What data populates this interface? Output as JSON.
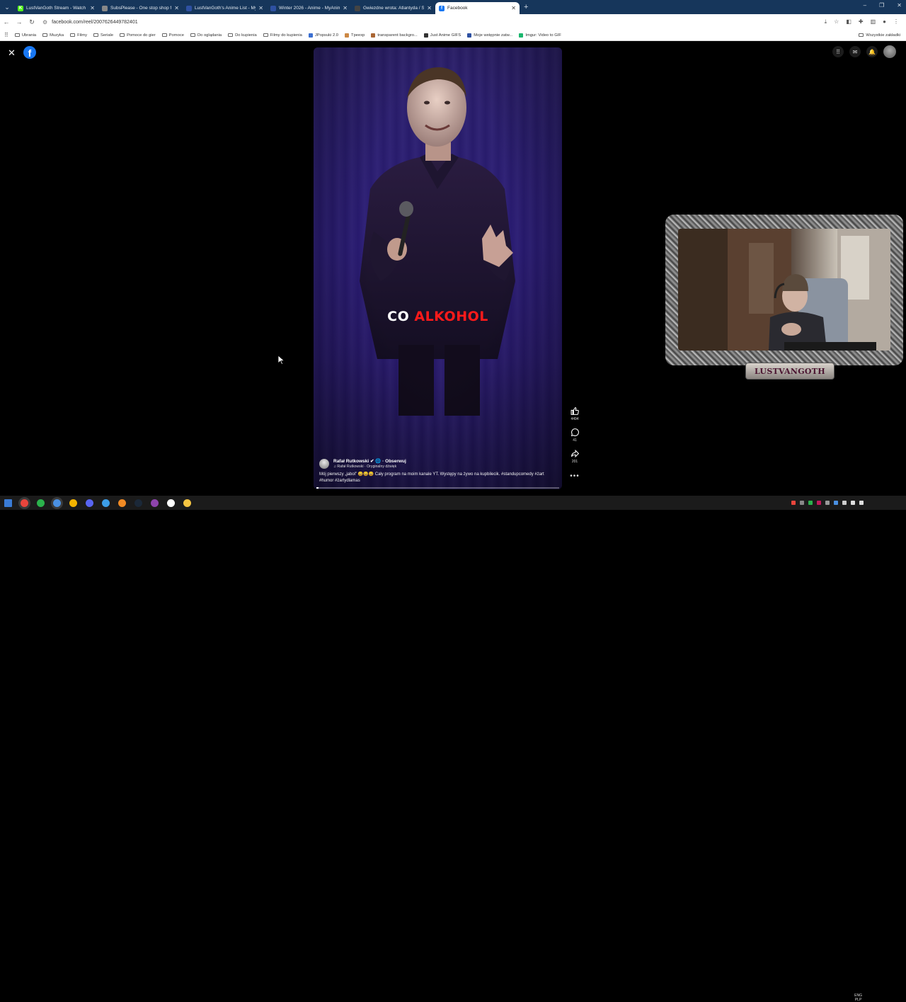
{
  "browser": {
    "tabs": [
      {
        "label": "LustVanGoth Stream - Watch L",
        "color": "#53fc18",
        "glyph": "K"
      },
      {
        "label": "SubsPlease - One stop shop fo",
        "color": "#888888",
        "glyph": ""
      },
      {
        "label": "LustVanGoth's Anime List - My",
        "color": "#2e51a2",
        "glyph": ""
      },
      {
        "label": "Winter 2026 - Anime - MyAnim",
        "color": "#2e51a2",
        "glyph": ""
      },
      {
        "label": "Gwiezdne wrota: Atlantyda / St",
        "color": "#444444",
        "glyph": ""
      },
      {
        "label": "Facebook",
        "color": "#1877f2",
        "glyph": "f"
      }
    ],
    "url": "facebook.com/reel/2007626449782401",
    "bookmarks": [
      {
        "label": "Ubrania",
        "kind": "folder"
      },
      {
        "label": "Muzyka",
        "kind": "folder"
      },
      {
        "label": "Filmy",
        "kind": "folder"
      },
      {
        "label": "Seriale",
        "kind": "folder"
      },
      {
        "label": "Pomoce do gier",
        "kind": "folder"
      },
      {
        "label": "Pomoce",
        "kind": "folder"
      },
      {
        "label": "Do oglądania",
        "kind": "folder"
      },
      {
        "label": "Do kupienia",
        "kind": "folder"
      },
      {
        "label": "Filmy do kupienia",
        "kind": "folder"
      },
      {
        "label": "JPopsuki 2.0",
        "kind": "site",
        "color": "#3b6fd1"
      },
      {
        "label": "Tpeexp",
        "kind": "site",
        "color": "#c84"
      },
      {
        "label": "transparent backgro...",
        "kind": "site",
        "color": "#a63"
      },
      {
        "label": "Just Anime GIFS",
        "kind": "site",
        "color": "#333"
      },
      {
        "label": "Moje wstępnie zatw...",
        "kind": "site",
        "color": "#2e51a2"
      },
      {
        "label": "Imgur: Video to GIF",
        "kind": "site",
        "color": "#1bb76e"
      }
    ],
    "bookmarks_right": "Wszystkie zakładki"
  },
  "reel": {
    "subtitle_word1": "CO",
    "subtitle_word2": "ALKOHOL",
    "author": "Rafał Rutkowski ✔ 🌐 · Obserwuj",
    "sound": "♫ Rafał Rutkowski · Oryginalny dźwięk",
    "caption": "Mój pierwszy „jabol” 😀😀😀 Cały program na moim kanale YT. Występy na żywo na kupbilecik. #standupcomedy #żart #humor #żartydlamas",
    "progress": 0.01,
    "likes": "4494",
    "comments": "41",
    "shares": "201"
  },
  "webcam": {
    "label": "LUSTVANGOTH"
  },
  "taskbar": {
    "apps": [
      "start",
      "chrome",
      "app-green",
      "app-blue",
      "app-yellow",
      "discord",
      "app-teal",
      "vlc",
      "steam",
      "app-purple",
      "obs",
      "explorer"
    ],
    "colors": [
      "#3a7bd5",
      "#e8453c",
      "#2bb24c",
      "#4a90e2",
      "#f4b400",
      "#5865f2",
      "#3c9ee8",
      "#f08a24",
      "#1b2838",
      "#8e44ad",
      "#ffffff",
      "#f5c542"
    ],
    "lang": "ENG",
    "sub": "PLP"
  },
  "colors": {
    "facebook_blue": "#1877f2",
    "subtitle_red": "#ff1a1a",
    "tabbar_bg": "#16365b"
  }
}
